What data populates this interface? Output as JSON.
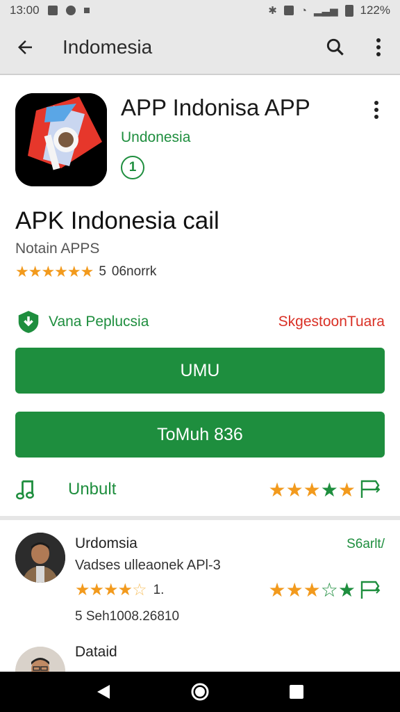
{
  "status": {
    "time": "13:00",
    "battery": "122%"
  },
  "appbar": {
    "title": "Indomesia"
  },
  "app": {
    "name": "APP Indonisa APP",
    "developer": "Undonesia",
    "badge": "1",
    "big_title": "APK Indonesia cail",
    "subtitle": "Notain APPS",
    "rating_value": "5",
    "rating_count": "06norrk"
  },
  "safety": {
    "label": "Vana Peplucsia",
    "right": "SkgestoonTuara"
  },
  "buttons": {
    "primary": "UMU",
    "secondary": "ToMuh 836"
  },
  "music": {
    "label": "Unbult"
  },
  "reviews": [
    {
      "name": "Urdomsia",
      "date": "S6arlt/",
      "text": "Vadses ulleaonek APl-3",
      "rating": "1.",
      "meta": "5 Seh1008.26810"
    },
    {
      "name": "Dataid"
    }
  ],
  "colors": {
    "accent": "#1e8e3e",
    "star": "#f29a1d",
    "warn": "#d93025"
  },
  "icons": [
    "back-arrow-icon",
    "search-icon",
    "more-vert-icon",
    "shield-download-icon",
    "music-note-icon",
    "flag-icon"
  ]
}
